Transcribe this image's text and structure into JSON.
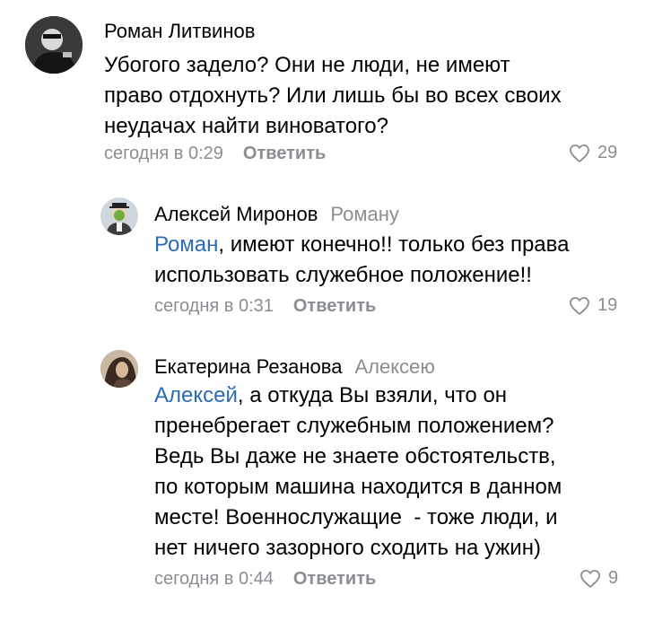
{
  "comments": [
    {
      "author": "Роман Литвинов",
      "reply_to": "",
      "mention": "",
      "text_lines": [
        "Убогого задело? Они не люди, не имеют",
        "право отдохнуть? Или лишь бы во всех своих",
        "неудачах найти виноватого?"
      ],
      "time": "сегодня в 0:29",
      "reply_label": "Ответить",
      "likes": "29"
    },
    {
      "author": "Алексей Миронов",
      "reply_to": "Роману",
      "mention": "Роман",
      "text_lines": [
        ", имеют конечно!! только без права",
        "использовать служебное положение!!"
      ],
      "time": "сегодня в 0:31",
      "reply_label": "Ответить",
      "likes": "19"
    },
    {
      "author": "Екатерина Резанова",
      "reply_to": "Алексею",
      "mention": "Алексей",
      "text_lines": [
        ", а откуда Вы взяли, что он",
        "пренебрегает служебным положением?",
        "Ведь Вы даже не знаете обстоятельств,",
        "по которым машина находится в данном",
        "месте! Военнослужащие  - тоже люди, и",
        "нет ничего зазорного сходить на ужин)"
      ],
      "time": "сегодня в 0:44",
      "reply_label": "Ответить",
      "likes": "9"
    }
  ]
}
